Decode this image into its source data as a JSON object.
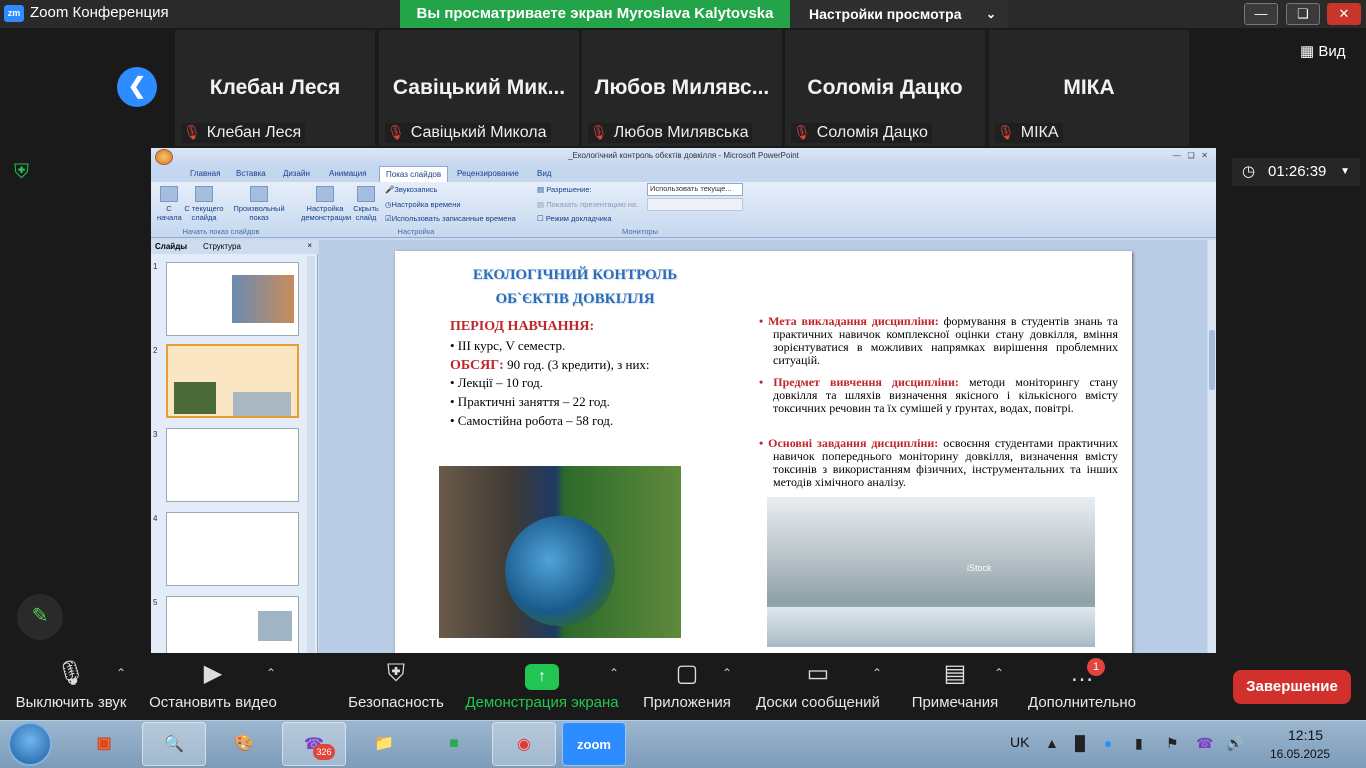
{
  "zoom": {
    "app_title": "Zoom Конференция",
    "logo_text": "zm",
    "share_banner": "Вы просматриваете экран Myroslava Kalytovska",
    "view_settings": "Настройки просмотра",
    "view_label": "Вид",
    "timer": "01:26:39",
    "participants": [
      {
        "big": "Клебан Леся",
        "small": "Клебан Леся"
      },
      {
        "big": "Савіцький Мик...",
        "small": "Савіцький Микола"
      },
      {
        "big": "Любов Милявс...",
        "small": "Любов Милявська"
      },
      {
        "big": "Соломія Дацко",
        "small": "Соломія Дацко"
      },
      {
        "big": "МІКА",
        "small": "МІКА"
      }
    ],
    "toolbar": {
      "mute": "Выключить звук",
      "video": "Остановить видео",
      "security": "Безопасность",
      "share": "Демонстрация экрана",
      "apps": "Приложения",
      "whiteboards": "Доски сообщений",
      "notes": "Примечания",
      "more": "Дополнительно",
      "more_badge": "1",
      "end": "Завершение"
    }
  },
  "ppt": {
    "window_title": "_Екологічний контроль обєктів довкілля - Microsoft PowerPoint",
    "tabs": [
      "Главная",
      "Вставка",
      "Дизайн",
      "Анимация",
      "Показ слайдов",
      "Рецензирование",
      "Вид"
    ],
    "ribbon": {
      "from_start": "С начала",
      "from_current": "С текущего слайда",
      "custom_show": "Произвольный показ",
      "group1": "Начать показ слайдов",
      "setup": "Настройка демонстрации",
      "hide": "Скрыть слайд",
      "record": "Звукозапись",
      "timing": "Настройка времени",
      "use_timings": "Использовать записанные времена",
      "group2": "Настройка",
      "resolution": "Разрешение:",
      "resolution_value": "Использовать текуще...",
      "show_on": "Показать презентацию на:",
      "presenter": "Режим докладчика",
      "group3": "Мониторы"
    },
    "pane_tabs": [
      "Слайды",
      "Структура"
    ],
    "thumb_numbers": [
      "1",
      "2",
      "3",
      "4",
      "5"
    ],
    "slide": {
      "title1": "ЕКОЛОГІЧНИЙ КОНТРОЛЬ",
      "title2": "ОБ`ЄКТІВ ДОВКІЛЛЯ",
      "period": "ПЕРІОД НАВЧАННЯ:",
      "course": "•   ІІІ курс, V семестр.",
      "volume_label": "ОБСЯГ:",
      "volume_text": " 90 год. (3 кредити), з них:",
      "lectures": "•  Лекції – 10 год.",
      "practice": "•  Практичні заняття – 22 год.",
      "selfwork": "•  Самостійна робота – 58 год.",
      "goal_label": "• Мета викладання дисципліни:",
      "goal_text": " формування в студентів знань та практичних навичок комплексної оцінки стану довкілля, вміння зорієнтуватися в можливих напрямках вирішення проблемних ситуацій.",
      "subject_label": "• Предмет вивчення дисципліни:",
      "subject_text": " методи моніторингу стану довкілля та шляхів визначення якісного і кількісного вмісту токсичних речовин та їх сумішей у ґрунтах, водах, повітрі.",
      "tasks_label": "• Основні завдання дисципліни:",
      "tasks_text": " освоєння студентами практичних навичок попереднього моніторину довкілля, визначення вмісту токсинів з використанням фізичних, інструментальних та інших методів хімічного аналізу.",
      "stock_label": "iStock"
    }
  },
  "taskbar": {
    "lang": "UK",
    "time": "12:15",
    "date": "16.05.2025",
    "viber_badge": "326",
    "zoom_app": "zoom"
  }
}
